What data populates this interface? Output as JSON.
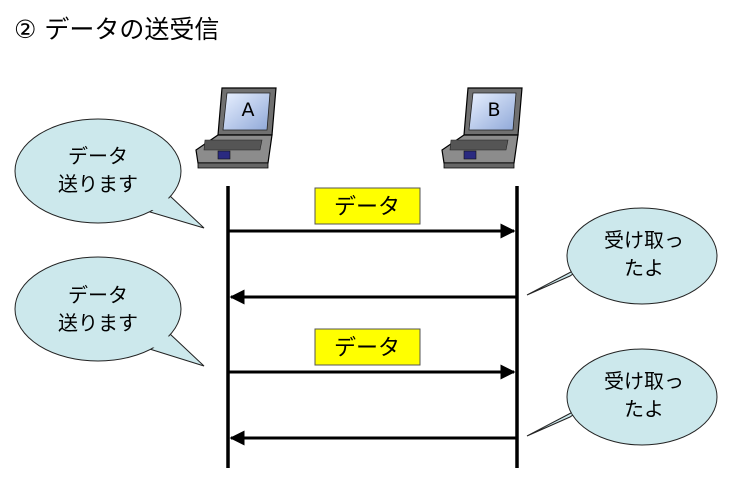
{
  "title": "② データの送受信",
  "computers": {
    "a_label": "A",
    "b_label": "B"
  },
  "bubbles": {
    "send_1": {
      "line1": "データ",
      "line2": "送ります"
    },
    "recv_1": {
      "line1": "受け取っ",
      "line2": "たよ"
    },
    "send_2": {
      "line1": "データ",
      "line2": "送ります"
    },
    "recv_2": {
      "line1": "受け取っ",
      "line2": "たよ"
    }
  },
  "data_labels": {
    "first": "データ",
    "second": "データ"
  },
  "colors": {
    "bubble_fill": "#cce8ec",
    "data_box_fill": "#ffff00",
    "laptop_body": "#8c8c8c",
    "laptop_screen": "#c8d8f0",
    "line": "#000000"
  }
}
